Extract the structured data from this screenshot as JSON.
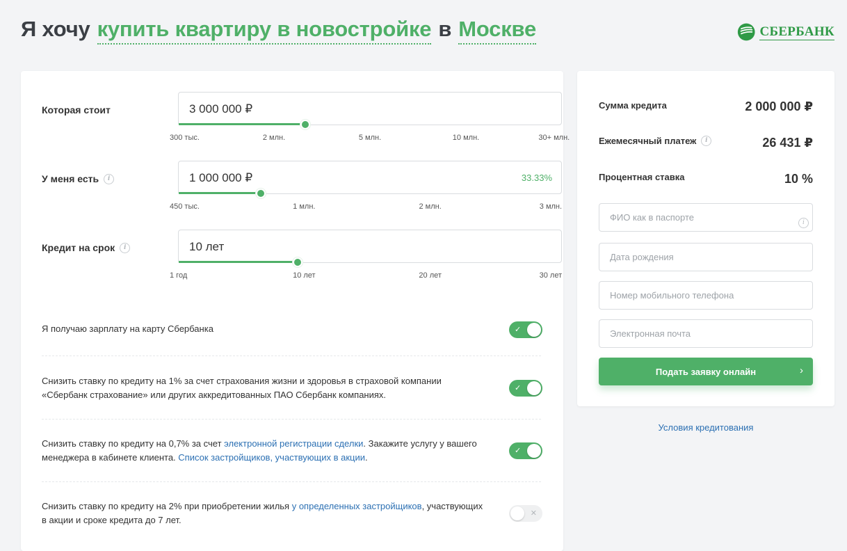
{
  "header": {
    "prefix": "Я хочу",
    "purpose": "купить квартиру в новостройке",
    "connector": "в",
    "city": "Москве",
    "bank_name": "СБЕРБАНК",
    "brand_color": "#2f9a46",
    "accent_color": "#4fb068"
  },
  "sliders": {
    "price": {
      "label": "Которая стоит",
      "value": "3 000 000 ₽",
      "fill_fraction": 0.33,
      "ticks": [
        "300 тыс.",
        "2 млн.",
        "5 млн.",
        "10 млн.",
        "30+ млн."
      ]
    },
    "down_payment": {
      "label": "У меня есть",
      "value": "1 000 000 ₽",
      "percent": "33.33%",
      "fill_fraction": 0.215,
      "ticks": [
        "450 тыс.",
        "1 млн.",
        "2 млн.",
        "3 млн."
      ]
    },
    "term": {
      "label": "Кредит на срок",
      "value": "10 лет",
      "fill_fraction": 0.31,
      "ticks": [
        "1 год",
        "10 лет",
        "20 лет",
        "30 лет"
      ]
    }
  },
  "options": {
    "salary": {
      "text": "Я получаю зарплату на карту Сбербанка",
      "enabled": true
    },
    "insurance": {
      "text": "Снизить ставку по кредиту на 1% за счет страхования жизни и здоровья в страховой компании «Сбербанк страхование» или других аккредитованных ПАО Сбербанк компаниях.",
      "enabled": true
    },
    "registration": {
      "text_1": "Снизить ставку по кредиту на 0,7% за счет ",
      "link_1": "электронной регистрации сделки",
      "text_2": ". Закажите услугу у вашего менеджера в кабинете клиента. ",
      "link_2": "Список застройщиков, участвующих в акции",
      "text_3": ".",
      "enabled": true
    },
    "developers": {
      "text_1": "Снизить ставку по кредиту на 2% при приобретении жилья ",
      "link_1": "у определенных застройщиков",
      "text_2": ", участвующих в акции и сроке кредита до 7 лет.",
      "enabled": false
    }
  },
  "summary": {
    "loan_amount_label": "Сумма кредита",
    "loan_amount_value": "2 000 000 ₽",
    "monthly_payment_label": "Ежемесячный платеж",
    "monthly_payment_value": "26 431 ₽",
    "rate_label": "Процентная ставка",
    "rate_value": "10 %"
  },
  "form": {
    "name_placeholder": "ФИО как в паспорте",
    "birth_placeholder": "Дата рождения",
    "phone_placeholder": "Номер мобильного телефона",
    "email_placeholder": "Электронная почта",
    "submit_label": "Подать заявку онлайн",
    "terms_link": "Условия кредитования"
  }
}
